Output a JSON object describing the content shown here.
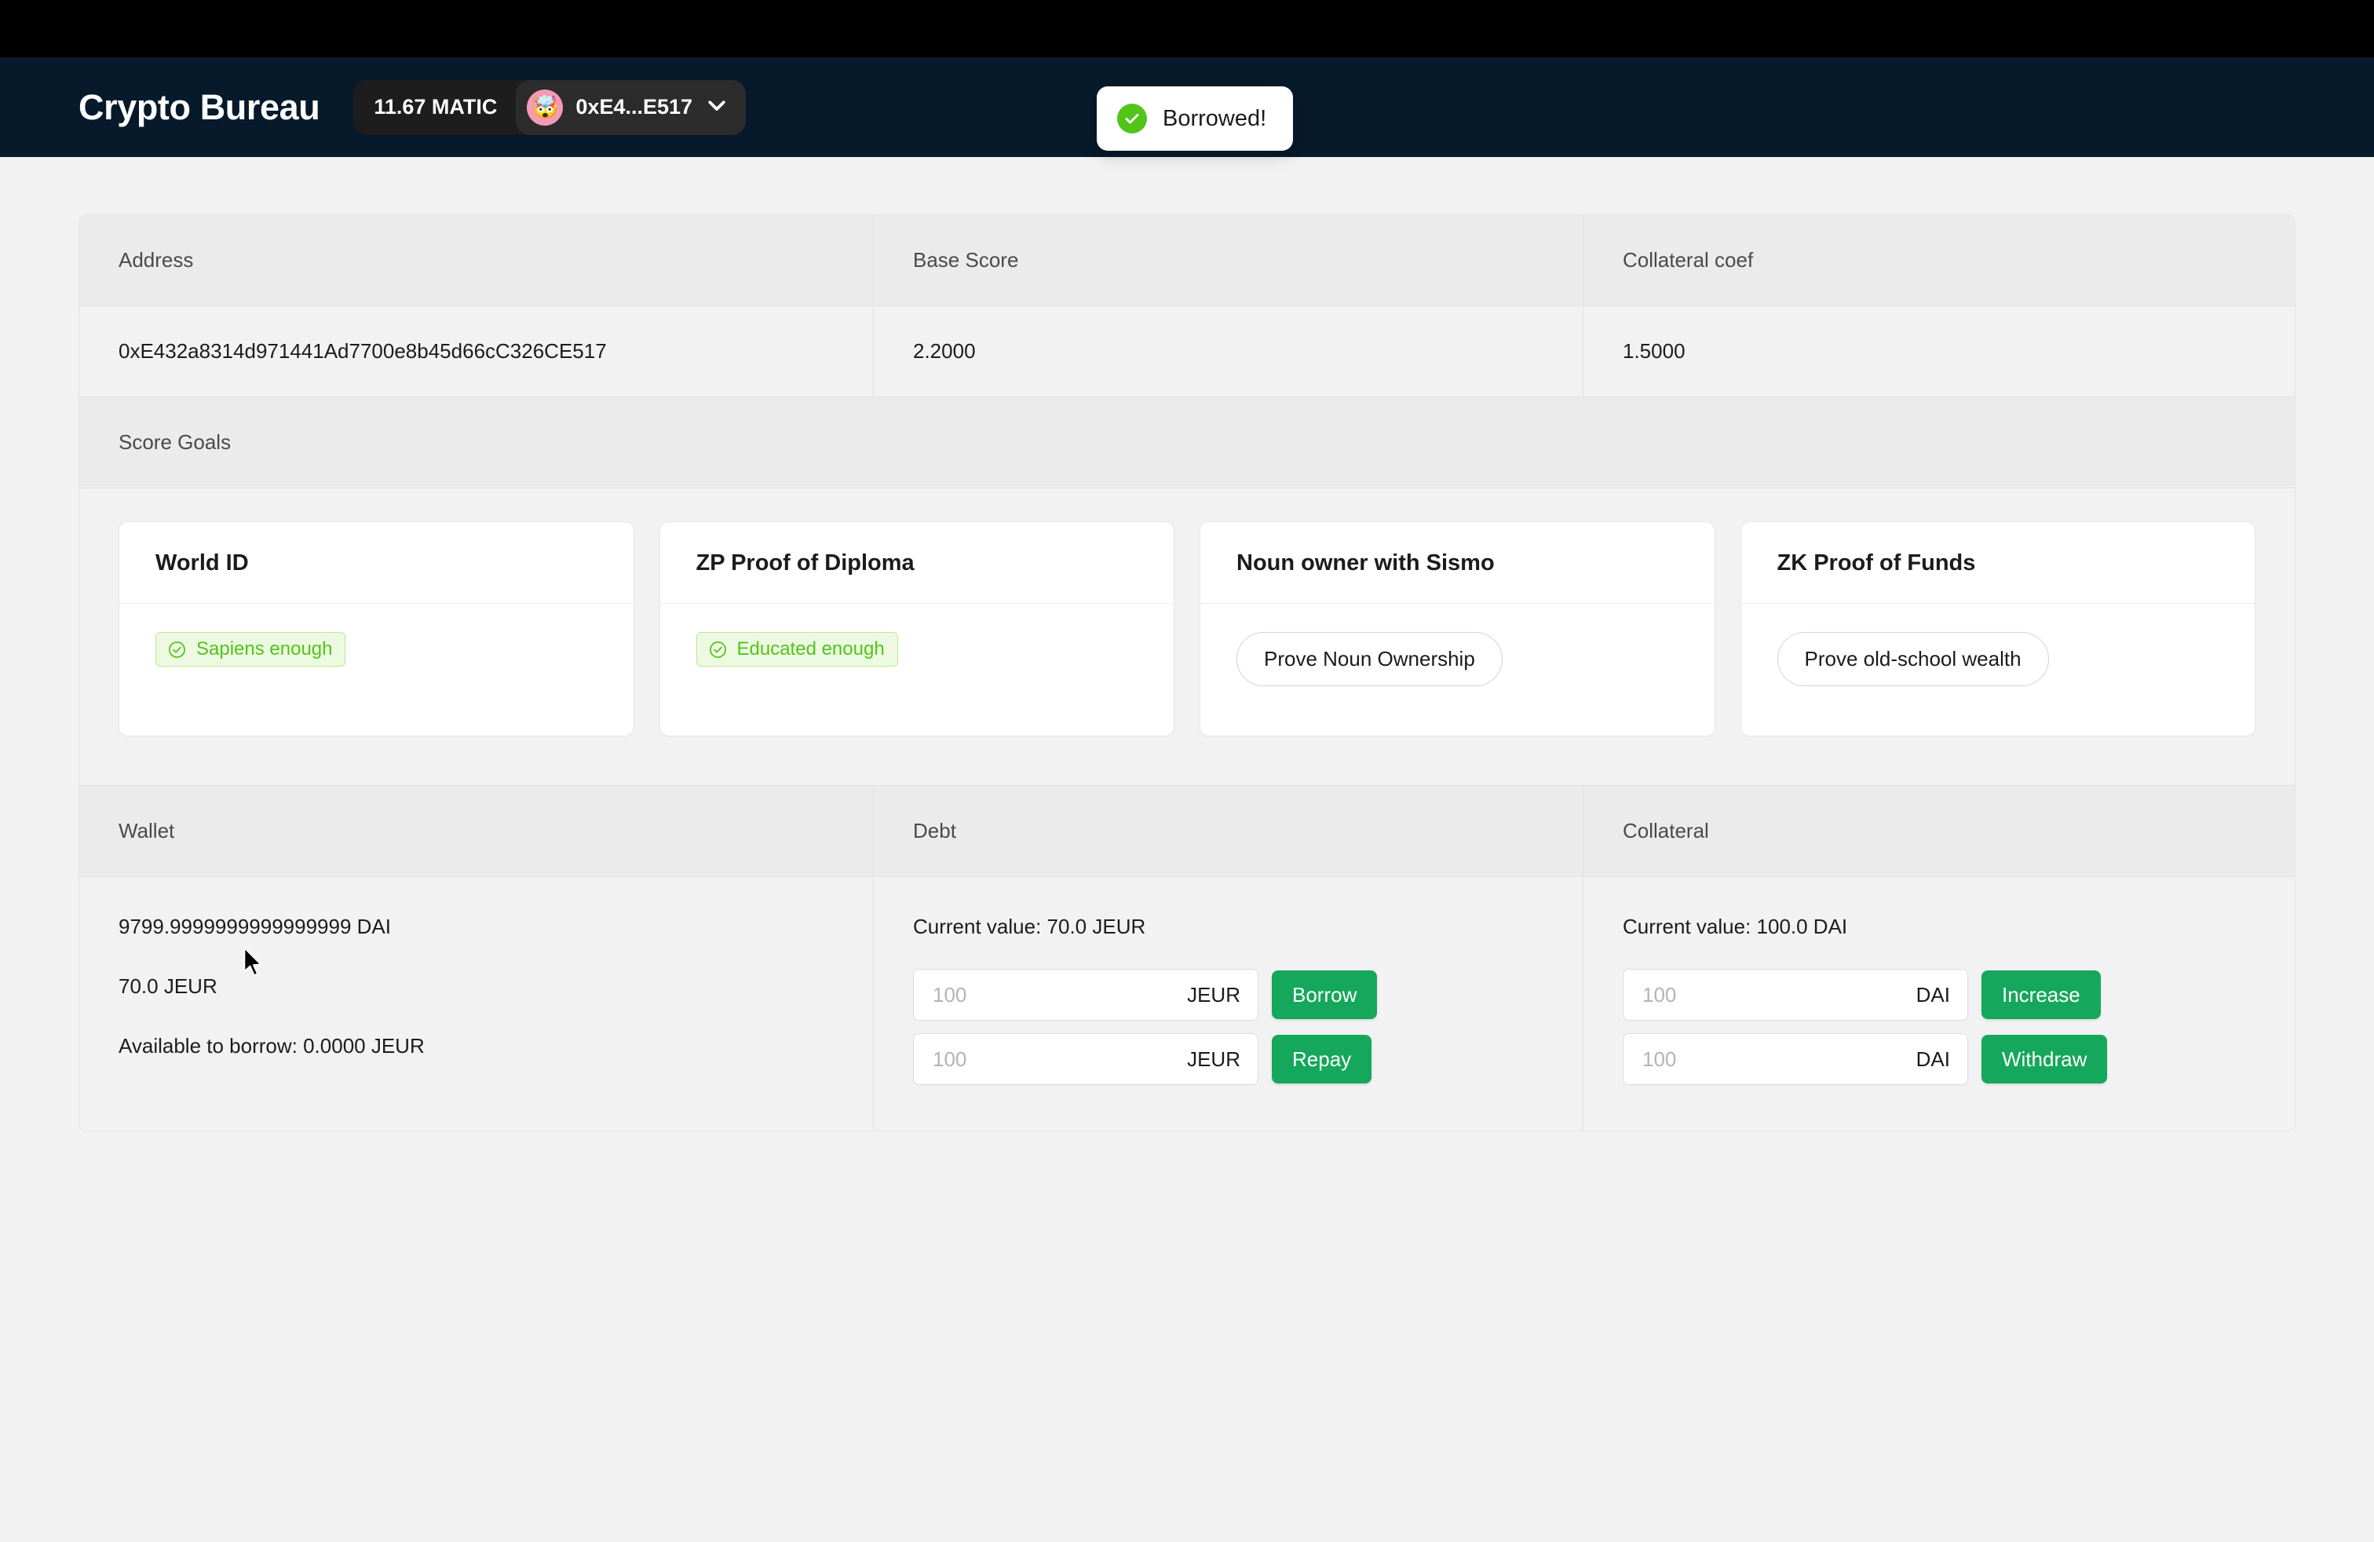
{
  "navbar": {
    "brand": "Crypto Bureau",
    "matic_balance": "11.67 MATIC",
    "address_short": "0xE4...E517",
    "avatar_emoji": "🤯",
    "chip_bg": "#1d1d1d",
    "pill_bg": "#2c2c2c",
    "navbar_bg": "#071a2b"
  },
  "toast": {
    "message": "Borrowed!",
    "icon": "check-circle-icon",
    "icon_color": "#52c41a"
  },
  "account_table": {
    "headers": [
      "Address",
      "Base Score",
      "Collateral coef"
    ],
    "values": [
      "0xE432a8314d971441Ad7700e8b45d66cC326CE517",
      "2.2000",
      "1.5000"
    ]
  },
  "score_goals": {
    "section_title": "Score Goals",
    "cards": [
      {
        "title": "World ID",
        "kind": "badge",
        "badge_label": "Sapiens enough",
        "badge_icon": "check-circle-outline-icon"
      },
      {
        "title": "ZP Proof of Diploma",
        "kind": "badge",
        "badge_label": "Educated enough",
        "badge_icon": "check-circle-outline-icon"
      },
      {
        "title": "Noun owner with Sismo",
        "kind": "button",
        "button_label": "Prove Noun Ownership"
      },
      {
        "title": "ZK Proof of Funds",
        "kind": "button",
        "button_label": "Prove old-school wealth"
      }
    ],
    "badge_color": "#52c41a",
    "badge_bg": "#edfae1"
  },
  "finance": {
    "headers": [
      "Wallet",
      "Debt",
      "Collateral"
    ],
    "wallet": {
      "lines": [
        "9799.9999999999999999 DAI",
        "70.0 JEUR",
        "Available to borrow: 0.0000 JEUR"
      ]
    },
    "debt": {
      "current_value": "Current value: 70.0 JEUR",
      "actions": [
        {
          "placeholder": "100",
          "value": "",
          "unit": "JEUR",
          "button": "Borrow"
        },
        {
          "placeholder": "100",
          "value": "",
          "unit": "JEUR",
          "button": "Repay"
        }
      ]
    },
    "collateral": {
      "current_value": "Current value: 100.0 DAI",
      "actions": [
        {
          "placeholder": "100",
          "value": "",
          "unit": "DAI",
          "button": "Increase"
        },
        {
          "placeholder": "100",
          "value": "",
          "unit": "DAI",
          "button": "Withdraw"
        }
      ]
    },
    "button_color": "#15a75b"
  }
}
